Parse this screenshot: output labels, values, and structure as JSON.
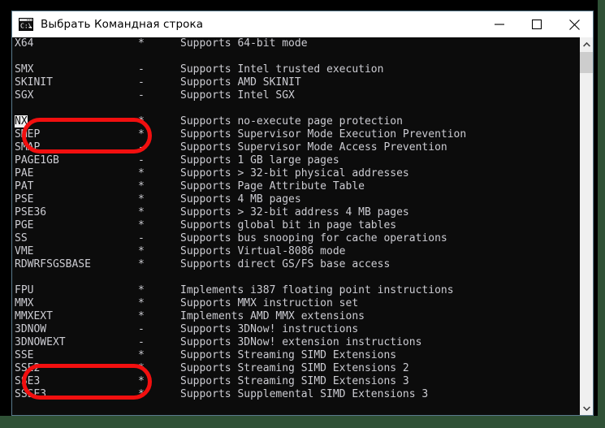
{
  "window": {
    "title": "Выбрать Командная строка",
    "icon": "command-prompt-icon",
    "controls": {
      "minimize": "minimize-icon",
      "maximize": "maximize-icon",
      "close": "close-icon"
    }
  },
  "colors": {
    "annotation": "#f20f0f",
    "console_bg": "#0c0c0c",
    "console_fg": "#ccccd2",
    "titlebar_bg": "#ffffff",
    "desktop_accent": "#2f5136",
    "selection_bg": "#f0f0f0"
  },
  "scrollbar": {
    "up_arrow": "chevron-up-icon",
    "down_arrow": "chevron-down-icon"
  },
  "console": {
    "rows": [
      {
        "name": "X64",
        "flag": "*",
        "desc": "Supports 64-bit mode"
      },
      {
        "name": "",
        "flag": "",
        "desc": ""
      },
      {
        "name": "SMX",
        "flag": "-",
        "desc": "Supports Intel trusted execution"
      },
      {
        "name": "SKINIT",
        "flag": "-",
        "desc": "Supports AMD SKINIT"
      },
      {
        "name": "SGX",
        "flag": "-",
        "desc": "Supports Intel SGX"
      },
      {
        "name": "",
        "flag": "",
        "desc": ""
      },
      {
        "name": "NX",
        "flag": "*",
        "desc": "Supports no-execute page protection",
        "selected": true
      },
      {
        "name": "SMEP",
        "flag": "*",
        "desc": "Supports Supervisor Mode Execution Prevention"
      },
      {
        "name": "SMAP",
        "flag": "-",
        "desc": "Supports Supervisor Mode Access Prevention"
      },
      {
        "name": "PAGE1GB",
        "flag": "-",
        "desc": "Supports 1 GB large pages"
      },
      {
        "name": "PAE",
        "flag": "*",
        "desc": "Supports > 32-bit physical addresses"
      },
      {
        "name": "PAT",
        "flag": "*",
        "desc": "Supports Page Attribute Table"
      },
      {
        "name": "PSE",
        "flag": "*",
        "desc": "Supports 4 MB pages"
      },
      {
        "name": "PSE36",
        "flag": "*",
        "desc": "Supports > 32-bit address 4 MB pages"
      },
      {
        "name": "PGE",
        "flag": "*",
        "desc": "Supports global bit in page tables"
      },
      {
        "name": "SS",
        "flag": "-",
        "desc": "Supports bus snooping for cache operations"
      },
      {
        "name": "VME",
        "flag": "*",
        "desc": "Supports Virtual-8086 mode"
      },
      {
        "name": "RDWRFSGSBASE",
        "flag": "*",
        "desc": "Supports direct GS/FS base access"
      },
      {
        "name": "",
        "flag": "",
        "desc": ""
      },
      {
        "name": "FPU",
        "flag": "*",
        "desc": "Implements i387 floating point instructions"
      },
      {
        "name": "MMX",
        "flag": "*",
        "desc": "Supports MMX instruction set"
      },
      {
        "name": "MMXEXT",
        "flag": "*",
        "desc": "Implements AMD MMX extensions"
      },
      {
        "name": "3DNOW",
        "flag": "-",
        "desc": "Supports 3DNow! instructions"
      },
      {
        "name": "3DNOWEXT",
        "flag": "-",
        "desc": "Supports 3DNow! extension instructions"
      },
      {
        "name": "SSE",
        "flag": "*",
        "desc": "Supports Streaming SIMD Extensions"
      },
      {
        "name": "SSE2",
        "flag": "*",
        "desc": "Supports Streaming SIMD Extensions 2"
      },
      {
        "name": "SSE3",
        "flag": "*",
        "desc": "Supports Streaming SIMD Extensions 3"
      },
      {
        "name": "SSSE3",
        "flag": "*",
        "desc": "Supports Supplemental SIMD Extensions 3"
      }
    ]
  },
  "annotations": [
    {
      "name": "nx-highlight",
      "target": "NX"
    },
    {
      "name": "sse2-highlight",
      "target": "SSE2"
    }
  ]
}
